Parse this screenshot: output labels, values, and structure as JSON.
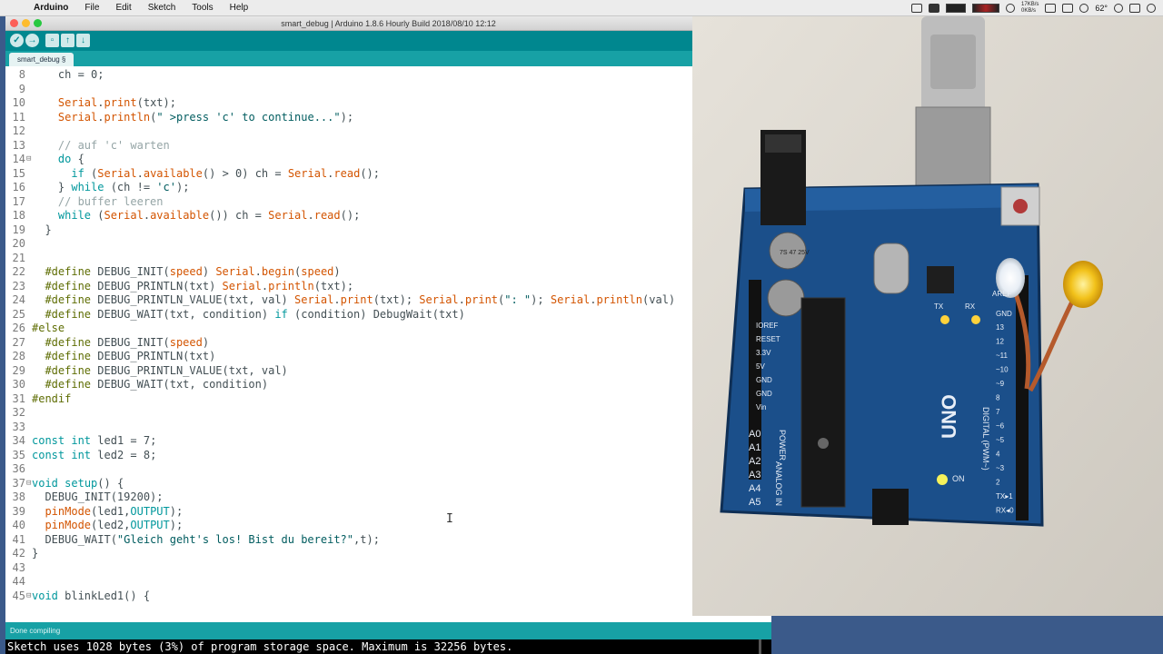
{
  "menubar": {
    "items": [
      "Arduino",
      "File",
      "Edit",
      "Sketch",
      "Tools",
      "Help"
    ],
    "status": {
      "net_up": "17KB/s",
      "net_down": "0KB/s",
      "temperature": "62°"
    }
  },
  "window": {
    "title": "smart_debug | Arduino 1.8.6 Hourly Build 2018/08/10 12:12",
    "tab_label": "smart_debug §"
  },
  "editor": {
    "lines": [
      {
        "n": "8",
        "fold": "",
        "html": "    ch = 0;"
      },
      {
        "n": "9",
        "fold": "",
        "html": ""
      },
      {
        "n": "10",
        "fold": "",
        "html": "    <span class='fn'>Serial</span>.<span class='fn'>print</span>(txt);"
      },
      {
        "n": "11",
        "fold": "",
        "html": "    <span class='fn'>Serial</span>.<span class='fn'>println</span>(<span class='st'>\" &gt;press 'c' to continue...\"</span>);"
      },
      {
        "n": "12",
        "fold": "",
        "html": ""
      },
      {
        "n": "13",
        "fold": "",
        "html": "    <span class='cm'>// auf 'c' warten</span>"
      },
      {
        "n": "14",
        "fold": "⊟",
        "html": "    <span class='kw'>do</span> {"
      },
      {
        "n": "15",
        "fold": "",
        "html": "      <span class='kw'>if</span> (<span class='fn'>Serial</span>.<span class='fn'>available</span>() &gt; 0) ch = <span class='fn'>Serial</span>.<span class='fn'>read</span>();"
      },
      {
        "n": "16",
        "fold": "",
        "html": "    } <span class='kw'>while</span> (ch != <span class='st'>'c'</span>);"
      },
      {
        "n": "17",
        "fold": "",
        "html": "    <span class='cm'>// buffer leeren</span>"
      },
      {
        "n": "18",
        "fold": "",
        "html": "    <span class='kw'>while</span> (<span class='fn'>Serial</span>.<span class='fn'>available</span>()) ch = <span class='fn'>Serial</span>.<span class='fn'>read</span>();"
      },
      {
        "n": "19",
        "fold": "",
        "html": "  }"
      },
      {
        "n": "20",
        "fold": "",
        "html": ""
      },
      {
        "n": "21",
        "fold": "",
        "html": ""
      },
      {
        "n": "22",
        "fold": "",
        "html": "  <span class='pp'>#define</span> DEBUG_INIT(<span class='fn'>speed</span>) <span class='fn'>Serial</span>.<span class='fn'>begin</span>(<span class='fn'>speed</span>)"
      },
      {
        "n": "23",
        "fold": "",
        "html": "  <span class='pp'>#define</span> DEBUG_PRINTLN(txt) <span class='fn'>Serial</span>.<span class='fn'>println</span>(txt);"
      },
      {
        "n": "24",
        "fold": "",
        "html": "  <span class='pp'>#define</span> DEBUG_PRINTLN_VALUE(txt, val) <span class='fn'>Serial</span>.<span class='fn'>print</span>(txt); <span class='fn'>Serial</span>.<span class='fn'>print</span>(<span class='st'>\": \"</span>); <span class='fn'>Serial</span>.<span class='fn'>println</span>(val)"
      },
      {
        "n": "25",
        "fold": "",
        "html": "  <span class='pp'>#define</span> DEBUG_WAIT(txt, condition) <span class='kw'>if</span> (condition) DebugWait(txt)"
      },
      {
        "n": "26",
        "fold": "",
        "html": "<span class='pp'>#else</span>"
      },
      {
        "n": "27",
        "fold": "",
        "html": "  <span class='pp'>#define</span> DEBUG_INIT(<span class='fn'>speed</span>)"
      },
      {
        "n": "28",
        "fold": "",
        "html": "  <span class='pp'>#define</span> DEBUG_PRINTLN(txt)"
      },
      {
        "n": "29",
        "fold": "",
        "html": "  <span class='pp'>#define</span> DEBUG_PRINTLN_VALUE(txt, val)"
      },
      {
        "n": "30",
        "fold": "",
        "html": "  <span class='pp'>#define</span> DEBUG_WAIT(txt, condition)"
      },
      {
        "n": "31",
        "fold": "",
        "html": "<span class='pp'>#endif</span>"
      },
      {
        "n": "32",
        "fold": "",
        "html": ""
      },
      {
        "n": "33",
        "fold": "",
        "html": ""
      },
      {
        "n": "34",
        "fold": "",
        "html": "<span class='kw'>const</span> <span class='kw'>int</span> led1 = 7;"
      },
      {
        "n": "35",
        "fold": "",
        "html": "<span class='kw'>const</span> <span class='kw'>int</span> led2 = 8;"
      },
      {
        "n": "36",
        "fold": "",
        "html": ""
      },
      {
        "n": "37",
        "fold": "⊟",
        "html": "<span class='kw'>void</span> <span class='kw'>setup</span>() {"
      },
      {
        "n": "38",
        "fold": "",
        "html": "  DEBUG_INIT(19200);"
      },
      {
        "n": "39",
        "fold": "",
        "html": "  <span class='fn'>pinMode</span>(led1,<span class='kw'>OUTPUT</span>);"
      },
      {
        "n": "40",
        "fold": "",
        "html": "  <span class='fn'>pinMode</span>(led2,<span class='kw'>OUTPUT</span>);"
      },
      {
        "n": "41",
        "fold": "",
        "html": "  DEBUG_WAIT(<span class='st'>\"Gleich geht's los! Bist du bereit?\"</span>,t);"
      },
      {
        "n": "42",
        "fold": "",
        "html": "}"
      },
      {
        "n": "43",
        "fold": "",
        "html": ""
      },
      {
        "n": "44",
        "fold": "",
        "html": ""
      },
      {
        "n": "45",
        "fold": "⊟",
        "html": "<span class='kw'>void</span> blinkLed1() {"
      }
    ]
  },
  "status_message": "Done compiling",
  "console_output": "Sketch uses 1028 bytes (3%) of program storage space. Maximum is 32256 bytes.",
  "photo": {
    "board_label": "UNO",
    "power_header_label": "POWER",
    "analog_header_label": "ANALOG IN",
    "digital_header_label": "DIGITAL (PWM~)",
    "on_label": "ON",
    "tx_label": "TX",
    "rx_label": "RX",
    "capacitor_label": "7S 47 25V",
    "aref_label": "AREF",
    "gnd_label": "GND",
    "power_pins": [
      "IOREF",
      "RESET",
      "3.3V",
      "5V",
      "GND",
      "GND",
      "Vin"
    ],
    "analog_pins": [
      "A0",
      "A1",
      "A2",
      "A3",
      "A4",
      "A5"
    ],
    "digital_pins": [
      "13",
      "12",
      "~11",
      "~10",
      "~9",
      "8",
      "7",
      "~6",
      "~5",
      "4",
      "~3",
      "2",
      "TX▸1",
      "RX◂0"
    ]
  },
  "colors": {
    "teal_dark": "#00878f",
    "teal_light": "#17a1a5",
    "keyword": "#00979c",
    "function": "#d35400",
    "comment": "#95a5a6"
  }
}
